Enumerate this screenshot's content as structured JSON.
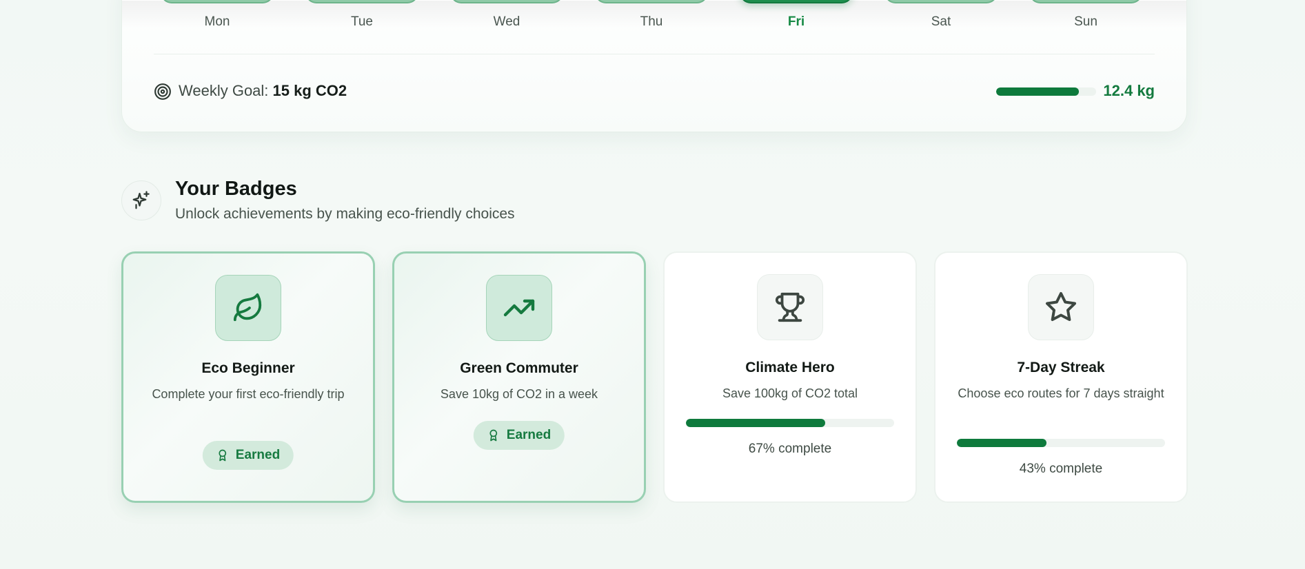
{
  "weekly": {
    "days": [
      {
        "label": "Mon",
        "active": false
      },
      {
        "label": "Tue",
        "active": false
      },
      {
        "label": "Wed",
        "active": false
      },
      {
        "label": "Thu",
        "active": false
      },
      {
        "label": "Fri",
        "active": true
      },
      {
        "label": "Sat",
        "active": false
      },
      {
        "label": "Sun",
        "active": false
      }
    ],
    "goal_label": "Weekly Goal:",
    "goal_value": "15 kg CO2",
    "current_value": "12.4 kg",
    "progress_fraction": 0.83,
    "goal_icon": "target-icon"
  },
  "badges_section": {
    "icon": "sparkles-icon",
    "title": "Your Badges",
    "subtitle": "Unlock achievements by making eco-friendly choices"
  },
  "badges": [
    {
      "name": "Eco Beginner",
      "description": "Complete your first eco-friendly trip",
      "earned": true,
      "earned_label": "Earned",
      "icon": "leaf-icon"
    },
    {
      "name": "Green Commuter",
      "description": "Save 10kg of CO2 in a week",
      "earned": true,
      "earned_label": "Earned",
      "icon": "trending-up-icon"
    },
    {
      "name": "Climate Hero",
      "description": "Save 100kg of CO2 total",
      "earned": false,
      "progress_fraction": 0.67,
      "progress_text": "67% complete",
      "icon": "trophy-icon"
    },
    {
      "name": "7-Day Streak",
      "description": "Choose eco routes for 7 days straight",
      "earned": false,
      "progress_fraction": 0.43,
      "progress_text": "43% complete",
      "icon": "star-icon"
    }
  ],
  "colors": {
    "accent": "#0e7a3c",
    "accent_light": "#d3eadc",
    "bar_inactive": "#8fcaa8",
    "bar_active": "#1e8f4e"
  }
}
